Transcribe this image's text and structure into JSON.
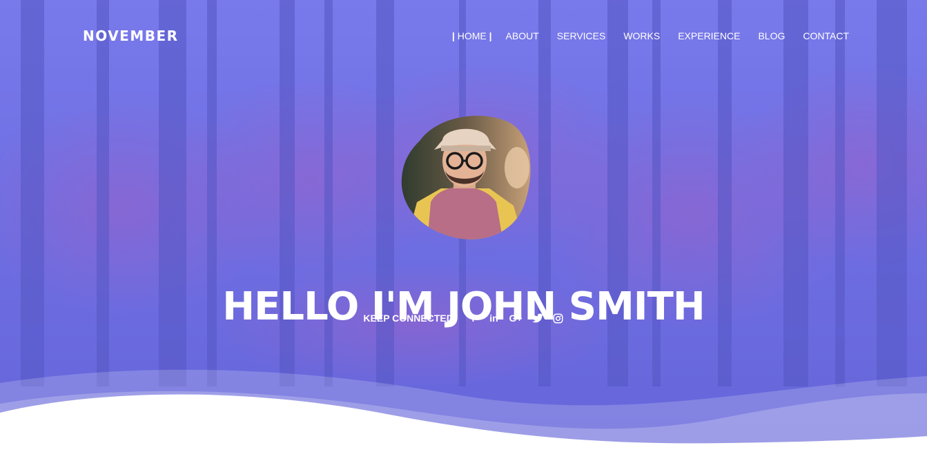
{
  "brand": {
    "name": "NOVEMBER"
  },
  "nav": {
    "items": [
      {
        "label": "HOME",
        "active": true
      },
      {
        "label": "ABOUT"
      },
      {
        "label": "SERVICES"
      },
      {
        "label": "WORKS"
      },
      {
        "label": "EXPERIENCE"
      },
      {
        "label": "BLOG"
      },
      {
        "label": "CONTACT"
      }
    ]
  },
  "hero": {
    "headline": "HELLO I'M JOHN SMITH",
    "avatar_icon": "profile-photo",
    "social_label": "KEEP CONNECTED:",
    "social": [
      {
        "icon": "facebook-icon",
        "glyph": "f"
      },
      {
        "icon": "linkedin-icon",
        "glyph": "in"
      },
      {
        "icon": "google-plus-icon",
        "glyph": "G+"
      },
      {
        "icon": "twitter-icon"
      },
      {
        "icon": "instagram-icon"
      }
    ]
  },
  "colors": {
    "overlay": "#6f6fe0",
    "text": "#ffffff",
    "wave": "#ffffff",
    "trees": "#4d4fc0",
    "foliage": "#9a4fb5"
  }
}
